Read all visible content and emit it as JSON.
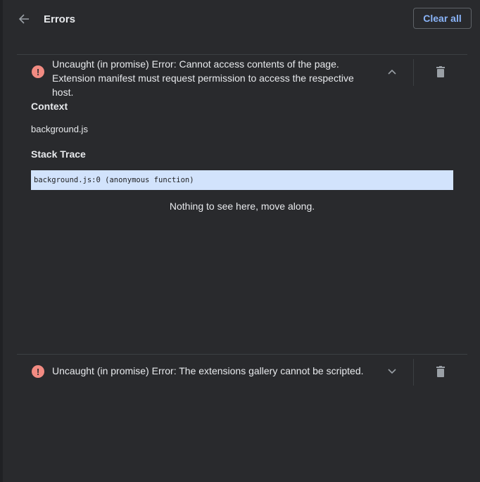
{
  "header": {
    "title": "Errors",
    "clear_all_label": "Clear all",
    "back_icon": "arrow-back-icon"
  },
  "errors": [
    {
      "message": "Uncaught (in promise) Error: Cannot access contents of the page. Extension manifest must request permission to access the respective host.",
      "expanded": true,
      "context_heading": "Context",
      "context_value": "background.js",
      "stack_heading": "Stack Trace",
      "stack_frames": [
        "background.js:0 (anonymous function)"
      ],
      "footer_text": "Nothing to see here, move along."
    },
    {
      "message": "Uncaught (in promise) Error: The extensions gallery cannot be scripted.",
      "expanded": false
    }
  ],
  "colors": {
    "background": "#292a2d",
    "error_icon": "#f28b82",
    "accent": "#8ab4f8",
    "stack_highlight": "#d2e3fc"
  }
}
